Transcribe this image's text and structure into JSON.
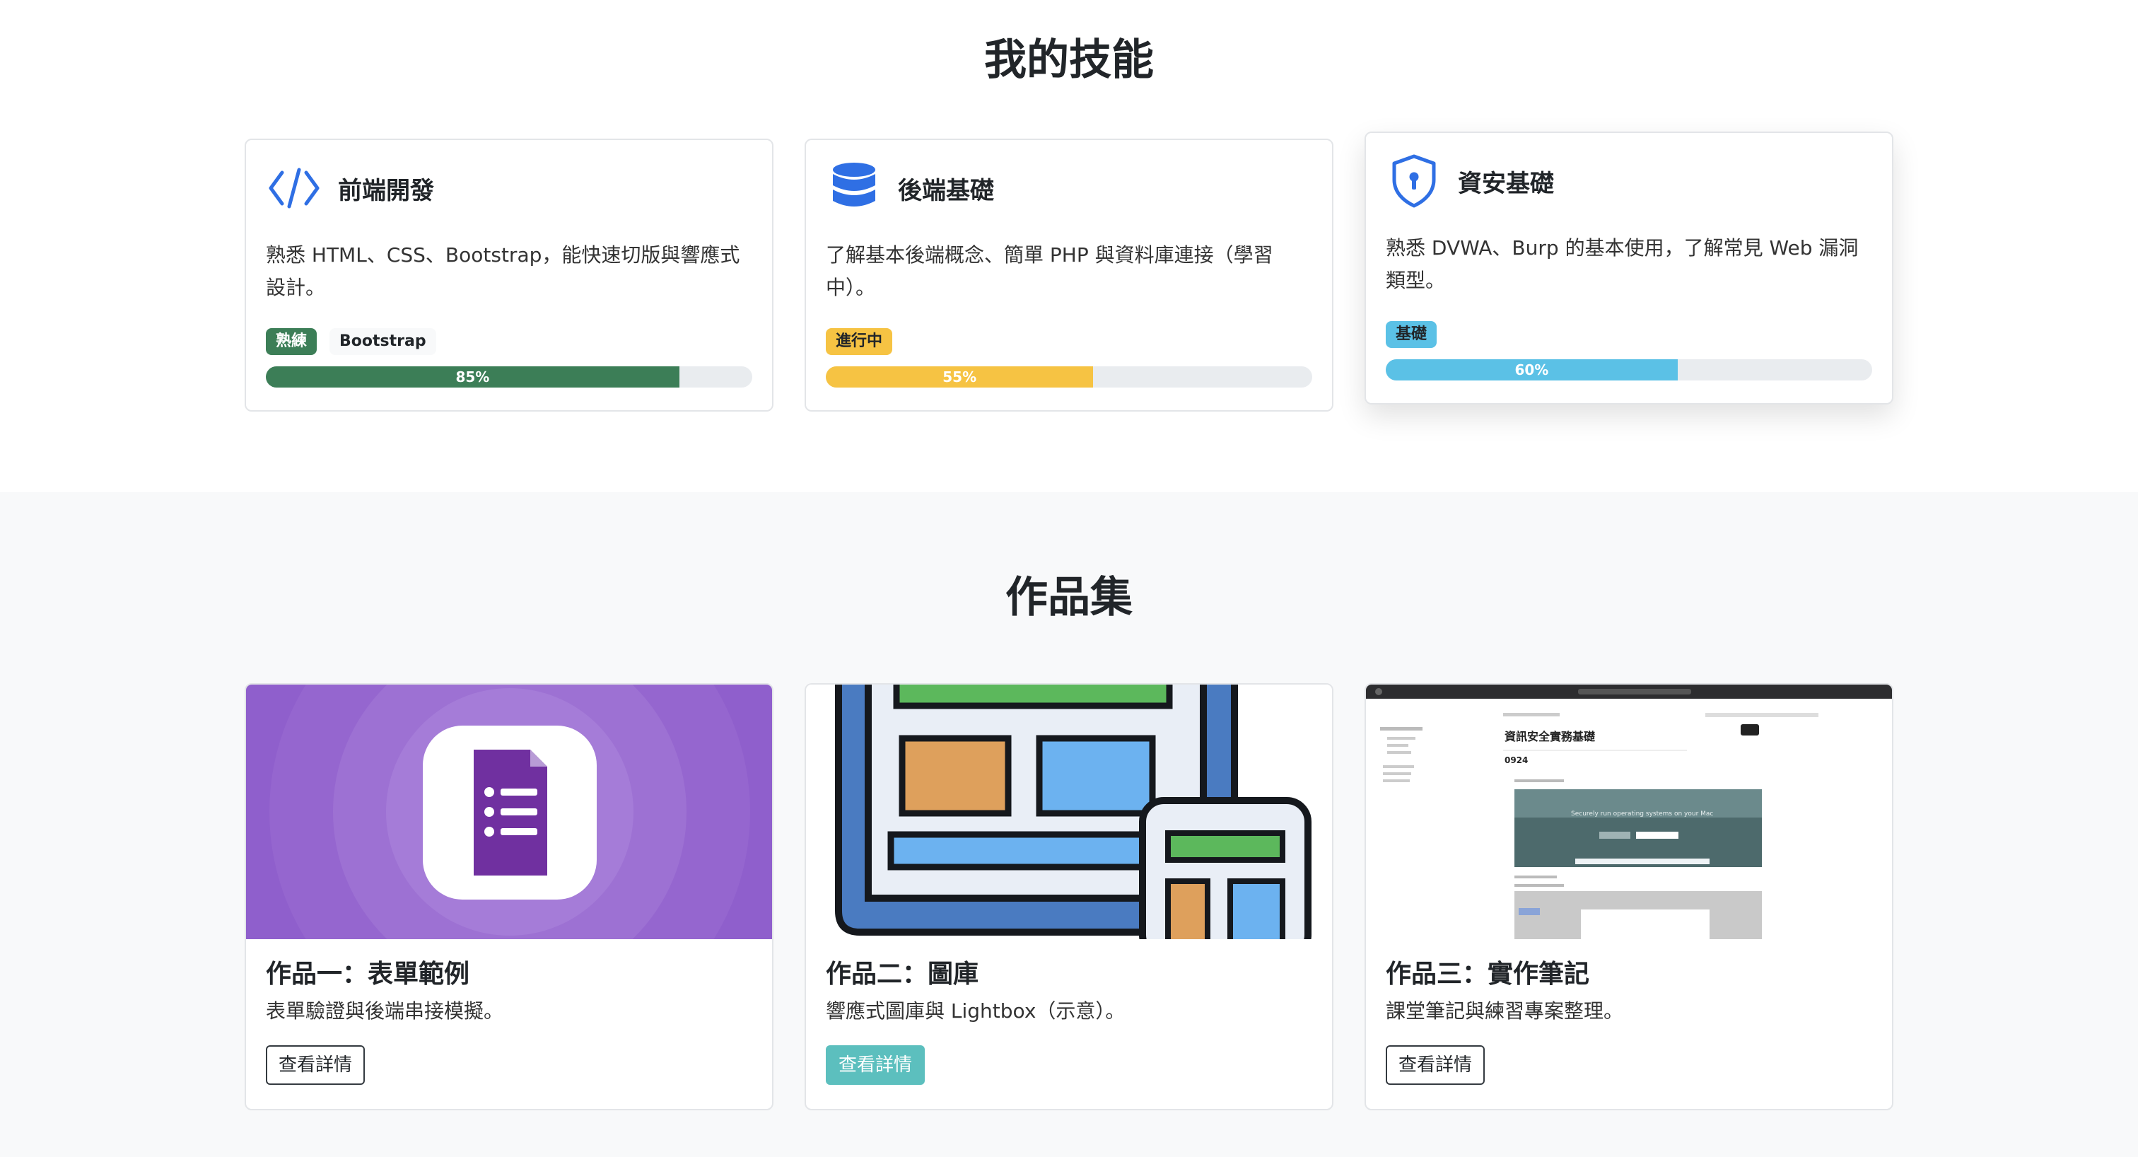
{
  "skills": {
    "title": "我的技能",
    "cards": [
      {
        "name": "前端開發",
        "icon": "code-icon",
        "description": "熟悉 HTML、CSS、Bootstrap，能快速切版與響應式設計。",
        "badges": [
          "熟練",
          "Bootstrap"
        ],
        "progress_label": "85%",
        "progress_value": 85,
        "color": "#3c7e57"
      },
      {
        "name": "後端基礎",
        "icon": "database-icon",
        "description": "了解基本後端概念、簡單 PHP 與資料庫連接（學習中）。",
        "badges": [
          "進行中"
        ],
        "progress_label": "55%",
        "progress_value": 55,
        "color": "#f6c343"
      },
      {
        "name": "資安基礎",
        "icon": "shield-keyhole-icon",
        "description": "熟悉 DVWA、Burp 的基本使用，了解常見 Web 漏洞類型。",
        "badges": [
          "基礎"
        ],
        "progress_label": "60%",
        "progress_value": 60,
        "color": "#5bc1e6"
      }
    ]
  },
  "portfolio": {
    "title": "作品集",
    "works": [
      {
        "title": "作品一：表單範例",
        "description": "表單驗證與後端串接模擬。",
        "button_label": "查看詳情",
        "thumbnail": "google-forms-icon"
      },
      {
        "title": "作品二：圖庫",
        "description": "響應式圖庫與 Lightbox（示意）。",
        "button_label": "查看詳情",
        "thumbnail": "gallery-illustration"
      },
      {
        "title": "作品三：實作筆記",
        "description": "課堂筆記與練習專案整理。",
        "button_label": "查看詳情",
        "thumbnail": "notes-screenshot",
        "screenshot_text": {
          "page_title": "資訊安全實務基礎",
          "date": "0924",
          "banner": "Securely run operating systems on your Mac"
        }
      }
    ]
  },
  "colors": {
    "accent_blue": "#2f6fe4",
    "forms_purple": "#7248b9",
    "teal_button": "#5cbfbe"
  }
}
